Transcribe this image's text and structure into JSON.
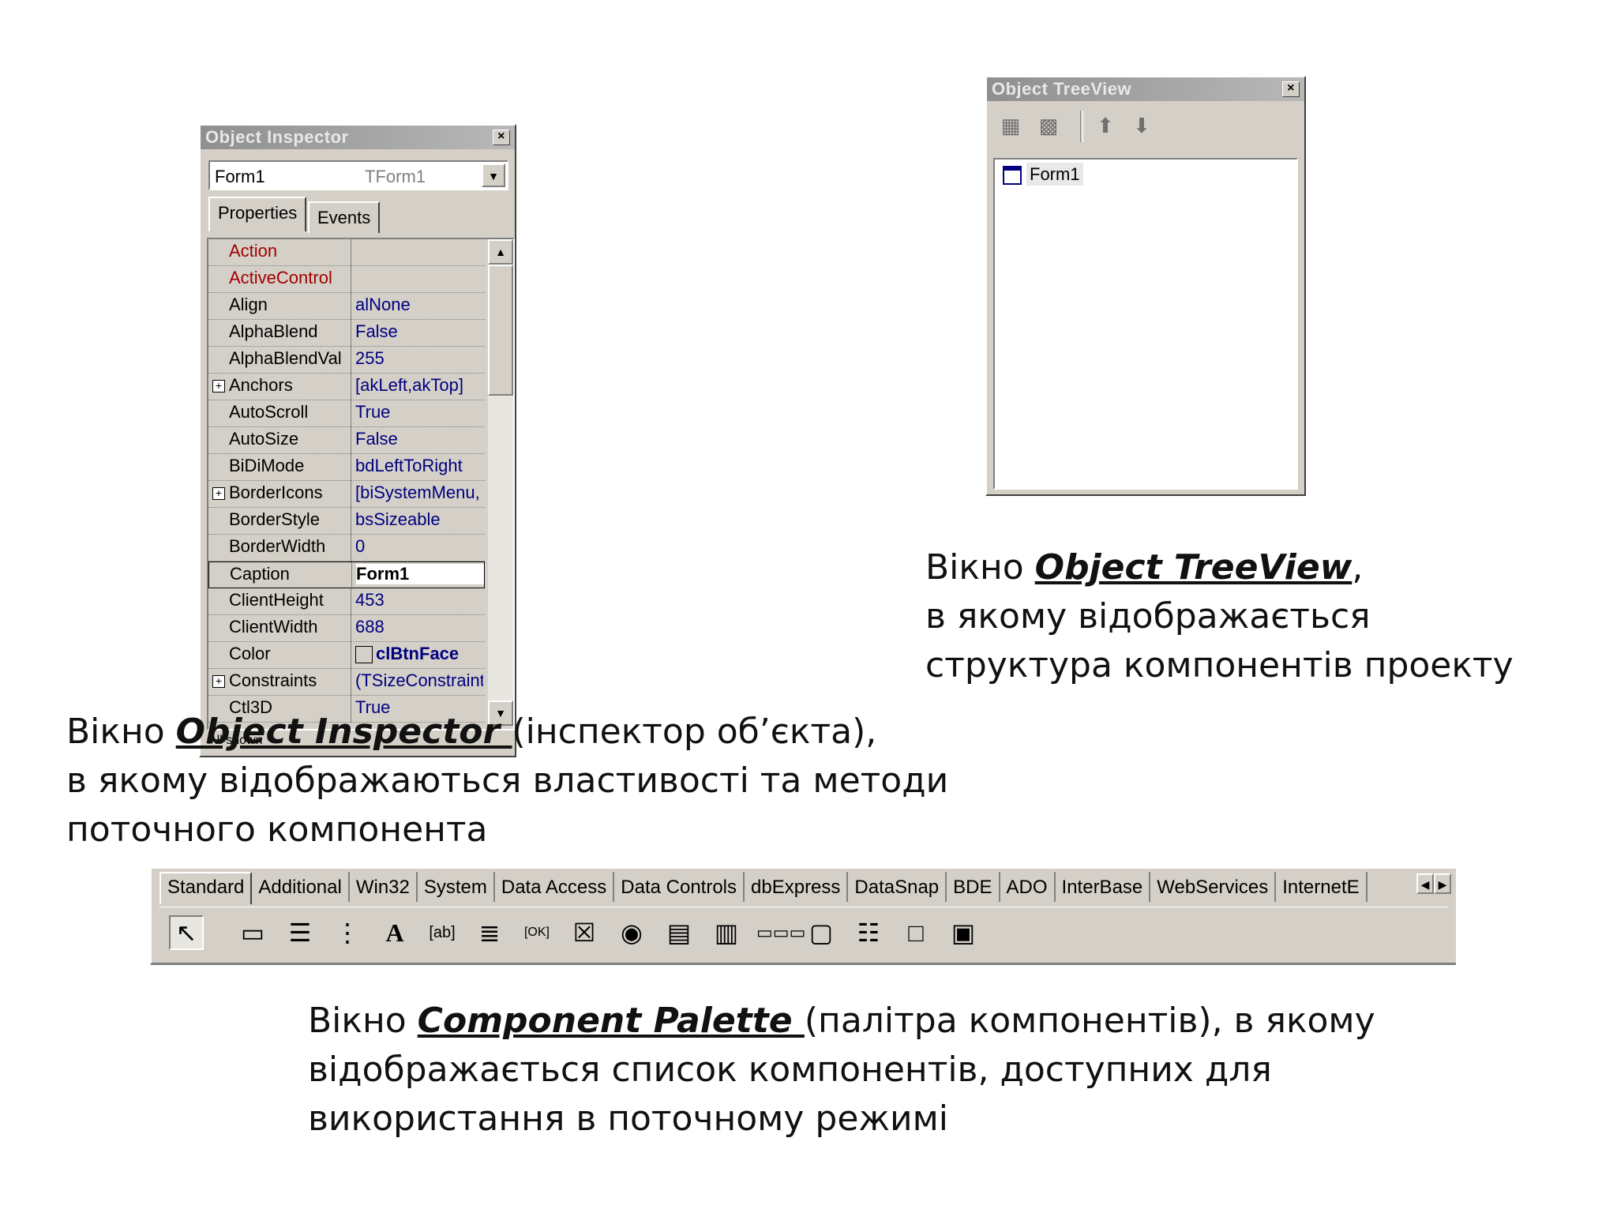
{
  "object_inspector": {
    "title": "Object Inspector",
    "combo_name": "Form1",
    "combo_type": "TForm1",
    "tabs": [
      "Properties",
      "Events"
    ],
    "rows": [
      {
        "name": "Action",
        "value": "",
        "ev": true
      },
      {
        "name": "ActiveControl",
        "value": "",
        "ev": true
      },
      {
        "name": "Align",
        "value": "alNone"
      },
      {
        "name": "AlphaBlend",
        "value": "False"
      },
      {
        "name": "AlphaBlendVal",
        "value": "255"
      },
      {
        "name": "Anchors",
        "value": "[akLeft,akTop]",
        "plus": true
      },
      {
        "name": "AutoScroll",
        "value": "True"
      },
      {
        "name": "AutoSize",
        "value": "False"
      },
      {
        "name": "BiDiMode",
        "value": "bdLeftToRight"
      },
      {
        "name": "BorderIcons",
        "value": "[biSystemMenu,",
        "plus": true
      },
      {
        "name": "BorderStyle",
        "value": "bsSizeable"
      },
      {
        "name": "BorderWidth",
        "value": "0"
      },
      {
        "name": "Caption",
        "value": "Form1",
        "sel": true
      },
      {
        "name": "ClientHeight",
        "value": "453"
      },
      {
        "name": "ClientWidth",
        "value": "688"
      },
      {
        "name": "Color",
        "value": "clBtnFace",
        "swatch": true
      },
      {
        "name": "Constraints",
        "value": "(TSizeConstraint",
        "plus": true
      },
      {
        "name": "Ctl3D",
        "value": "True"
      }
    ],
    "status": "All shown"
  },
  "object_treeview": {
    "title": "Object TreeView",
    "node": "Form1"
  },
  "captions": {
    "inspector": {
      "prefix": "Вікно ",
      "em": "Object Inspector ",
      "rest": "(інспектор об’єкта),",
      "line2": "в якому відображаються властивості та методи",
      "line3": "поточного компонента"
    },
    "treeview": {
      "prefix": "Вікно ",
      "em": "Object TreeView",
      "rest": ",",
      "line2": "в якому відображається",
      "line3": "структура компонентів проекту"
    },
    "palette": {
      "prefix": "Вікно ",
      "em": "Component  Palette ",
      "rest": "(палітра компонентів), в якому",
      "line2": "відображається список компонентів, доступних для",
      "line3": "використання в поточному режимі"
    }
  },
  "palette": {
    "tabs": [
      "Standard",
      "Additional",
      "Win32",
      "System",
      "Data Access",
      "Data Controls",
      "dbExpress",
      "DataSnap",
      "BDE",
      "ADO",
      "InterBase",
      "WebServices",
      "InternetE"
    ],
    "icons": [
      "pointer-icon",
      "frames-icon",
      "mainmenu-icon",
      "popupmenu-icon",
      "label-icon",
      "edit-icon",
      "memo-icon",
      "button-icon",
      "checkbox-icon",
      "radiobutton-icon",
      "listbox-icon",
      "combobox-icon",
      "scrollbar-icon",
      "groupbox-icon",
      "radiogroup-icon",
      "panel-icon",
      "actionlist-icon"
    ]
  }
}
